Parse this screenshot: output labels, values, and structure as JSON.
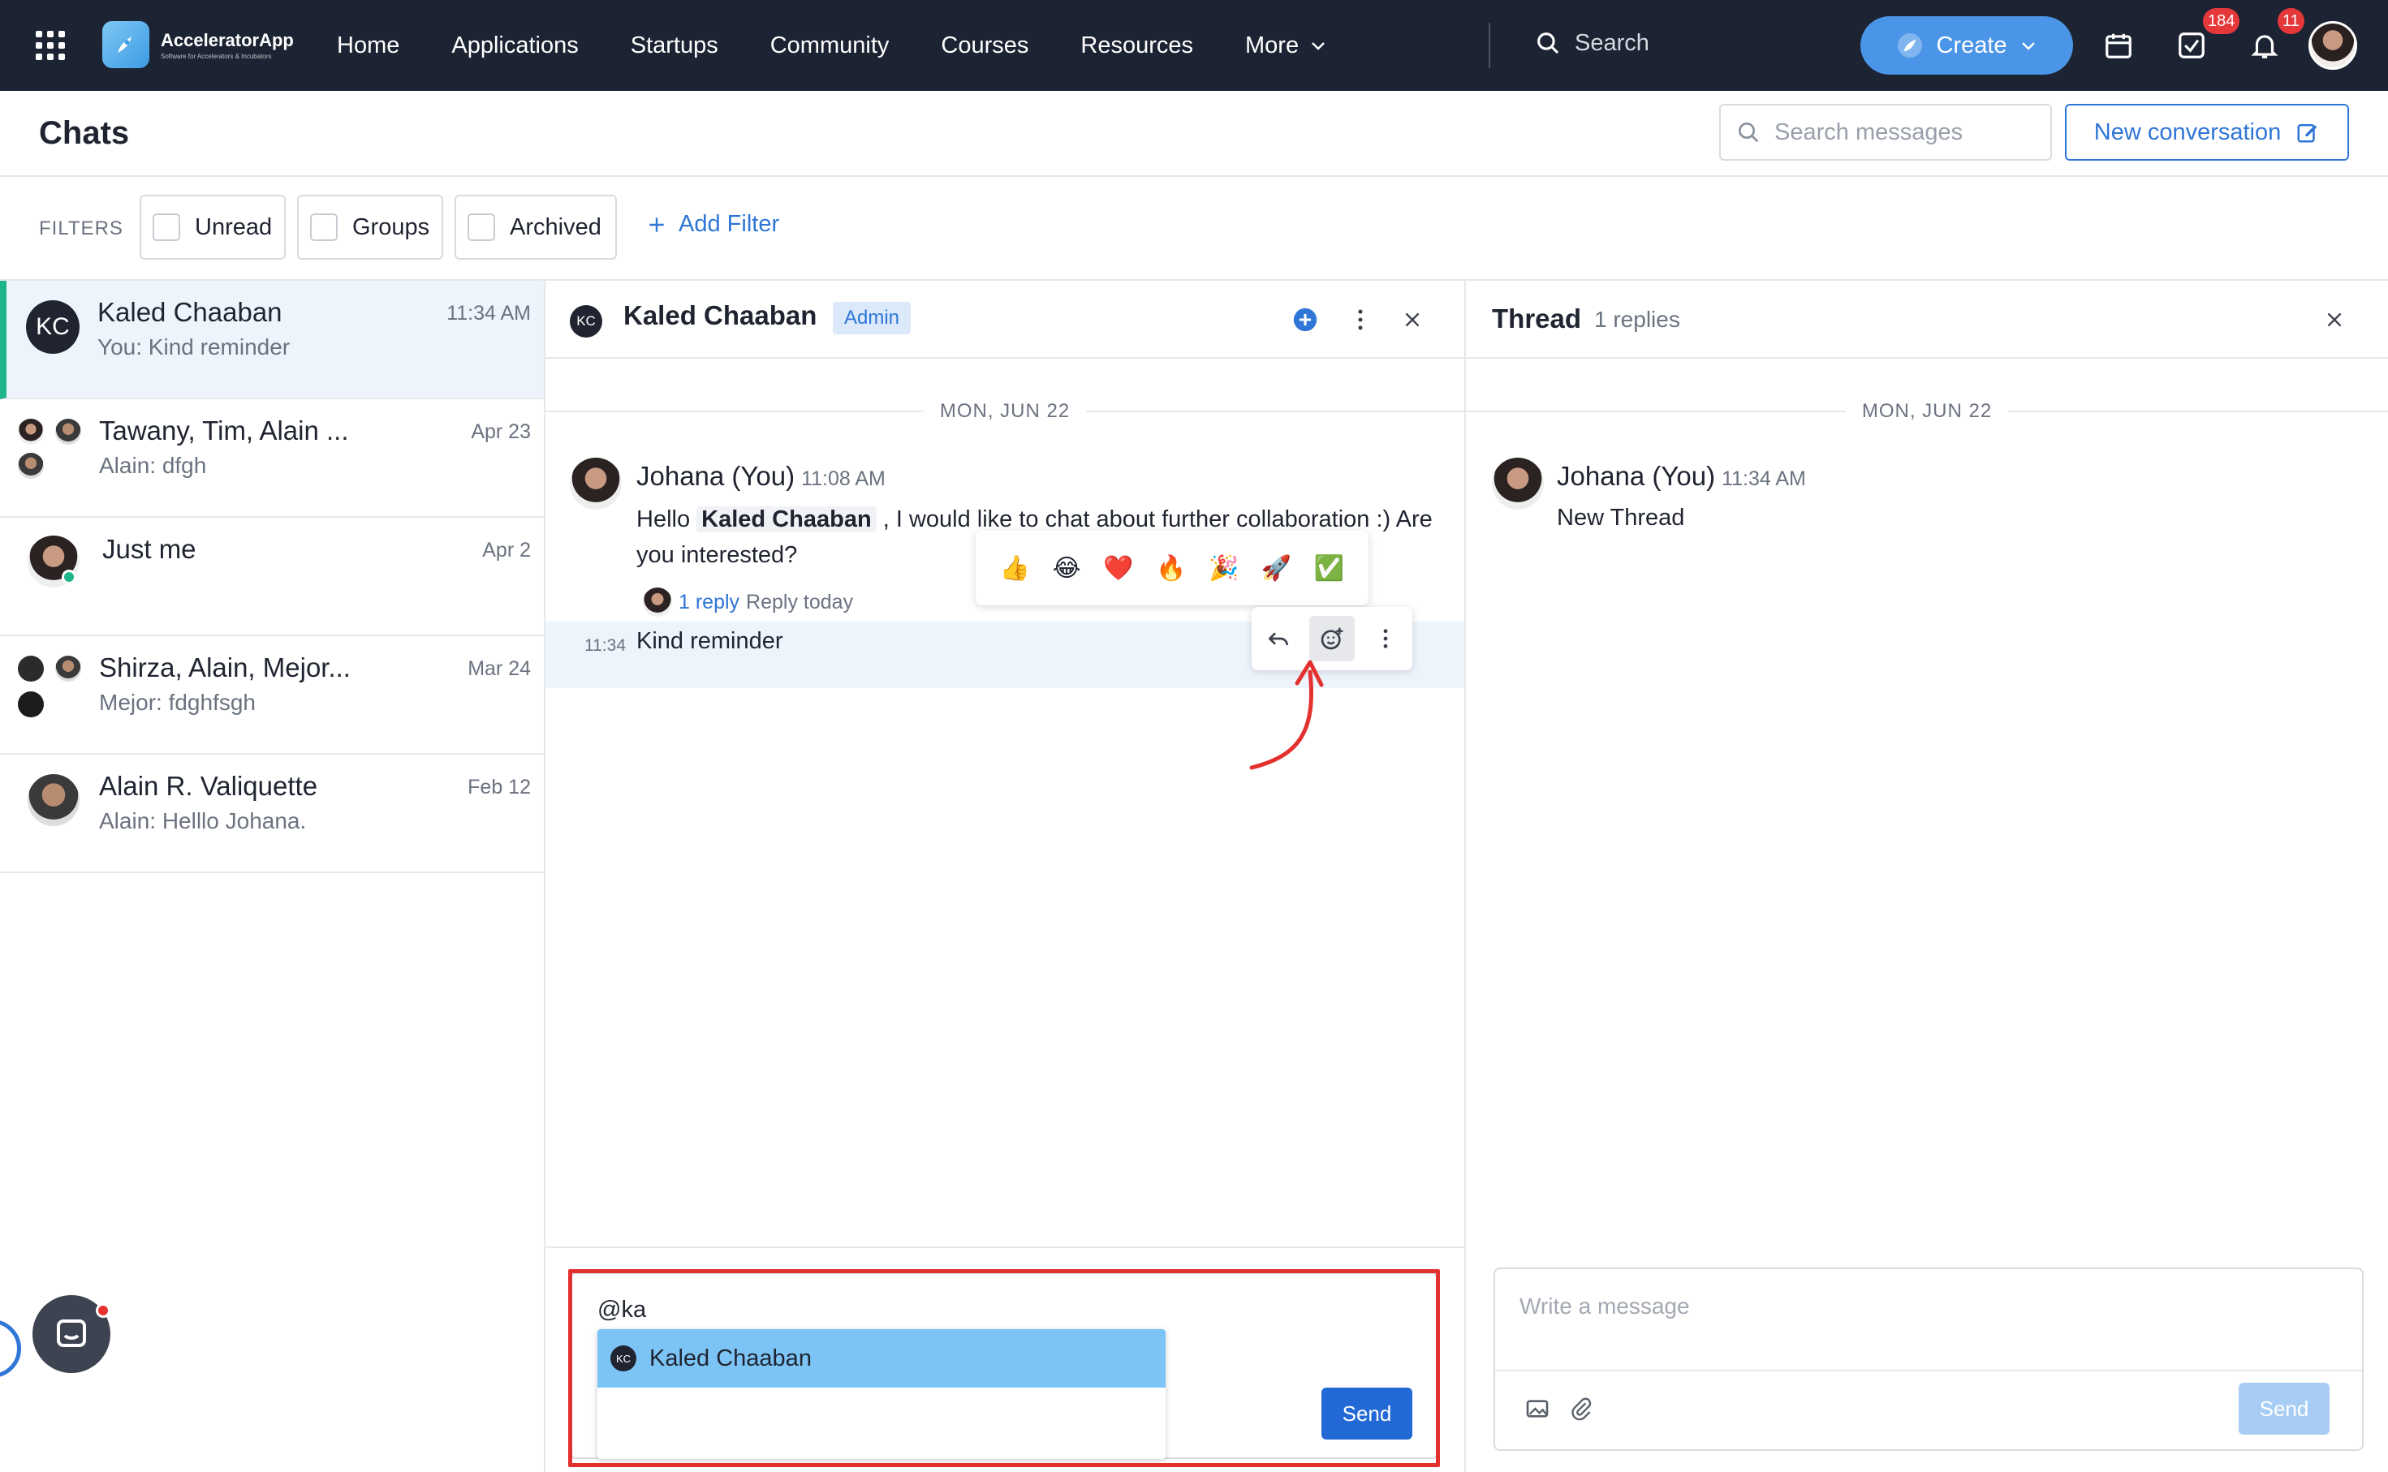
{
  "nav": {
    "brand": "AcceleratorApp",
    "brand_tagline": "Software for Accelerators & Incubators",
    "links": [
      "Home",
      "Applications",
      "Startups",
      "Community",
      "Courses",
      "Resources",
      "More"
    ],
    "search_label": "Search",
    "create_label": "Create",
    "tasks_badge": "184",
    "notifications_badge": "11"
  },
  "header": {
    "title": "Chats",
    "search_placeholder": "Search messages",
    "new_conversation": "New conversation"
  },
  "filters": {
    "label": "FILTERS",
    "chips": [
      "Unread",
      "Groups",
      "Archived"
    ],
    "add_filter": "Add Filter"
  },
  "conversations": [
    {
      "initials": "KC",
      "name": "Kaled Chaaban",
      "preview": "You: Kind reminder",
      "date": "11:34 AM"
    },
    {
      "name": "Tawany, Tim, Alain ...",
      "preview": "Alain: dfgh",
      "date": "Apr 23"
    },
    {
      "name": "Just me",
      "preview": "",
      "date": "Apr 2"
    },
    {
      "name": "Shirza, Alain, Mejor...",
      "preview": "Mejor: fdghfsgh",
      "date": "Mar 24"
    },
    {
      "name": "Alain R. Valiquette",
      "preview": "Alain: Helllo Johana.",
      "date": "Feb 12"
    }
  ],
  "chat": {
    "avatar_initials": "KC",
    "name": "Kaled Chaaban",
    "role_badge": "Admin",
    "date_divider": "MON, JUN 22",
    "message": {
      "author": "Johana (You)",
      "time": "11:08 AM",
      "text_before": "Hello",
      "mention": "Kaled Chaaban",
      "text_after": ", I would like to chat about further collaboration :) Are you interested?",
      "reply_count": "1 reply",
      "reply_when": "Reply today"
    },
    "followup": {
      "time": "11:34",
      "text": "Kind reminder"
    },
    "reactions": [
      "👍",
      "😂",
      "❤️",
      "🔥",
      "🎉",
      "🚀",
      "✅"
    ],
    "composer_text": "@ka",
    "mention_suggestion": {
      "initials": "KC",
      "name": "Kaled Chaaban"
    },
    "send_label": "Send"
  },
  "thread": {
    "title": "Thread",
    "count": "1 replies",
    "date_divider": "MON, JUN 22",
    "message": {
      "author": "Johana (You)",
      "time": "11:34 AM",
      "text": "New Thread"
    },
    "composer_placeholder": "Write a message",
    "send_label": "Send"
  },
  "colors": {
    "nav_bg": "#1c2332",
    "accent": "#2f76d6",
    "create_button": "#4b95e8",
    "active_marker": "#1db589",
    "badge": "#e5383b",
    "highlight_frame": "#e3312f"
  }
}
